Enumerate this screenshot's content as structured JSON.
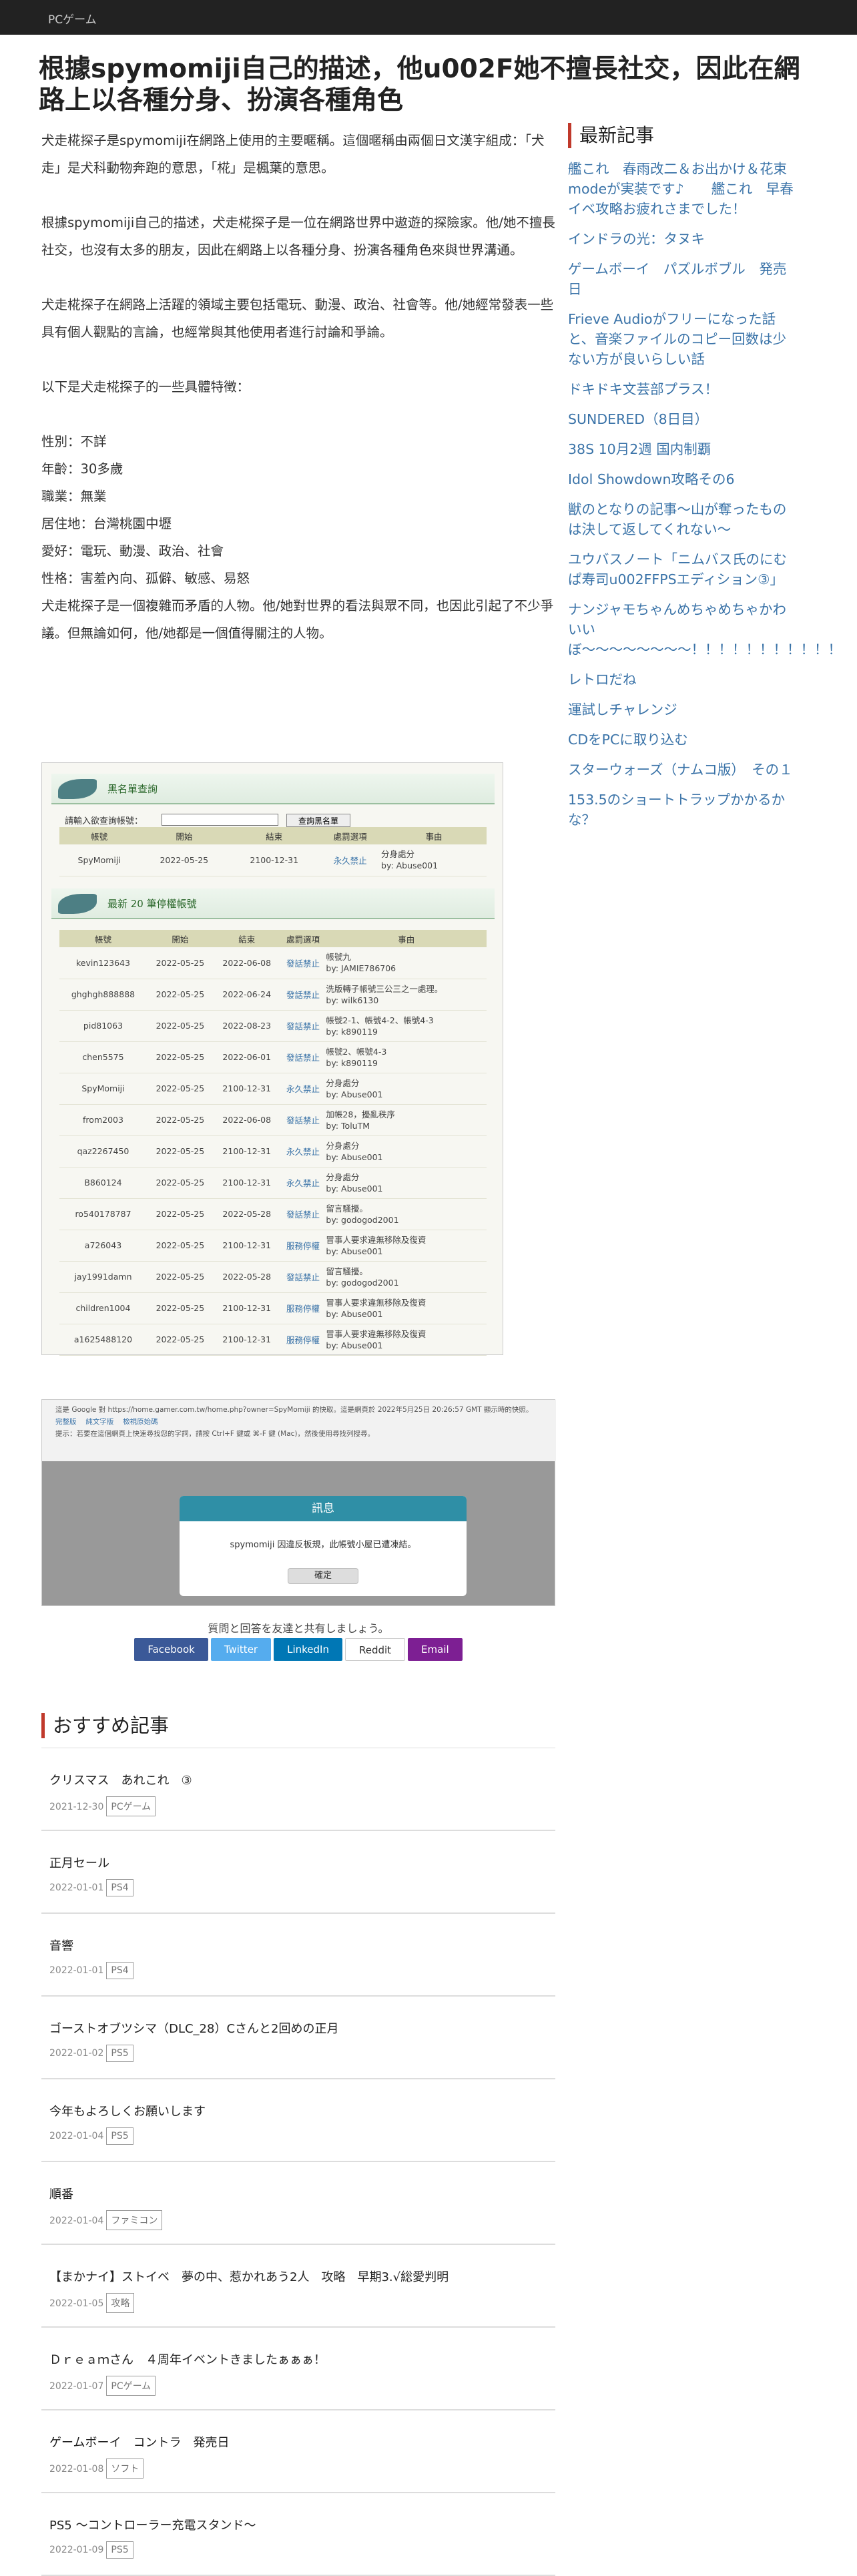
{
  "topbar": {
    "category": "PCゲーム"
  },
  "article": {
    "title": "根據spymomiji自己的描述，他u002F她不擅長社交，因此在網路上以各種分身、扮演各種角色",
    "paragraphs": [
      "犬走椛探子是spymomiji在網路上使用的主要暱稱。這個暱稱由兩個日文漢字組成：「犬走」是犬科動物奔跑的意思，「椛」是楓葉的意思。",
      "根據spymomiji自己的描述，犬走椛探子是一位在網路世界中遨遊的探險家。他/她不擅長社交，也沒有太多的朋友，因此在網路上以各種分身、扮演各種角色來與世界溝通。",
      "犬走椛探子在網路上活躍的領域主要包括電玩、動漫、政治、社會等。他/她經常發表一些具有個人觀點的言論，也經常與其他使用者進行討論和爭論。",
      "以下是犬走椛探子的一些具體特徵："
    ],
    "traits": [
      "性別：不詳",
      "年齡：30多歲",
      "職業：無業",
      "居住地：台灣桃園中壢",
      "愛好：電玩、動漫、政治、社會",
      "性格：害羞內向、孤僻、敏感、易怒"
    ],
    "closing": "犬走椛探子是一個複雜而矛盾的人物。他/她對世界的看法與眾不同，也因此引起了不少爭議。但無論如何，他/她都是一個值得關注的人物。"
  },
  "sidebar": {
    "heading": "最新記事",
    "items": [
      "艦これ　春雨改二＆お出かけ＆花束modeが実装です♪　　艦これ　早春イベ攻略お疲れさまでした！",
      "インドラの光：タヌキ",
      "ゲームボーイ　パズルボブル　発売日",
      "Frieve Audioがフリーになった話と、音楽ファイルのコピー回数は少ない方が良いらしい話",
      "ドキドキ文芸部プラス！",
      "SUNDERED（8日目）",
      "38S 10月2週 国内制覇",
      "Idol Showdown攻略その6",
      "獣のとなりの記事〜山が奪ったものは決して返してくれない〜",
      "ユウバスノート「ニムバス氏のにむぱ寿司u002FFPSエディション③」",
      "ナンジャモちゃんめちゃめちゃかわいいぼ〜〜〜〜〜〜〜〜！！！！！！！！！！！",
      "レトロだね",
      "運試しチャレンジ",
      "CDをPCに取り込む",
      "スターウォーズ（ナムコ版）　その１",
      "153.5のショートトラップかかるかな？"
    ]
  },
  "screenshot1": {
    "panel1_title": "黑名單查詢",
    "query_label": "請輸入欲查詢帳號：",
    "query_button": "查詢黑名單",
    "headers": [
      "帳號",
      "開始",
      "結束",
      "處罰選項",
      "事由"
    ],
    "search_row": [
      "SpyMomiji",
      "2022-05-25",
      "2100-12-31",
      "永久禁止",
      "分身處分",
      "by: Abuse001"
    ],
    "panel2_title": "最新 20 筆停權帳號",
    "rows": [
      [
        "kevin123643",
        "2022-05-25",
        "2022-06-08",
        "發話禁止",
        "帳號九",
        "by: JAMIE786706"
      ],
      [
        "ghghgh888888",
        "2022-05-25",
        "2022-06-24",
        "發話禁止",
        "洗版轉子帳號三公三之一處理。",
        "by: wilk6130"
      ],
      [
        "pid81063",
        "2022-05-25",
        "2022-08-23",
        "發話禁止",
        "帳號2-1、帳號4-2、帳號4-3",
        "by: k890119"
      ],
      [
        "chen5575",
        "2022-05-25",
        "2022-06-01",
        "發話禁止",
        "帳號2、帳號4-3",
        "by: k890119"
      ],
      [
        "SpyMomiji",
        "2022-05-25",
        "2100-12-31",
        "永久禁止",
        "分身處分",
        "by: Abuse001"
      ],
      [
        "from2003",
        "2022-05-25",
        "2022-06-08",
        "發話禁止",
        "加帳28，擾亂秩序",
        "by: ToluTM"
      ],
      [
        "qaz2267450",
        "2022-05-25",
        "2100-12-31",
        "永久禁止",
        "分身處分",
        "by: Abuse001"
      ],
      [
        "B860124",
        "2022-05-25",
        "2100-12-31",
        "永久禁止",
        "分身處分",
        "by: Abuse001"
      ],
      [
        "ro540178787",
        "2022-05-25",
        "2022-05-28",
        "發話禁止",
        "留言騷擾。",
        "by: godogod2001"
      ],
      [
        "a726043",
        "2022-05-25",
        "2100-12-31",
        "服務停權",
        "冒事人要求違無移除及復資",
        "by: Abuse001"
      ],
      [
        "jay1991damn",
        "2022-05-25",
        "2022-05-28",
        "發話禁止",
        "留言騷擾。",
        "by: godogod2001"
      ],
      [
        "children1004",
        "2022-05-25",
        "2100-12-31",
        "服務停權",
        "冒事人要求違無移除及復資",
        "by: Abuse001"
      ],
      [
        "a1625488120",
        "2022-05-25",
        "2100-12-31",
        "服務停權",
        "冒事人要求違無移除及復資",
        "by: Abuse001"
      ]
    ]
  },
  "screenshot2": {
    "header_line": "這是 Google 對 https://home.gamer.com.tw/home.php?owner=SpyMomiji 的快取。這是網頁於 2022年5月25日 20:26:57 GMT 顯示時的快照。",
    "links": [
      "完整版",
      "純文字版",
      "檢視原始碼"
    ],
    "notice": "提示：若要在這個網頁上快速尋找您的字詞，請按 Ctrl+F 鍵或 ⌘-F 鍵 (Mac)，然後使用尋找列搜尋。",
    "dialog_title": "訊息",
    "dialog_message": "spymomiji 因違反板規，此帳號小屋已遭凍結。",
    "dialog_button": "確定"
  },
  "share": {
    "label": "質問と回答を友達と共有しましょう。",
    "buttons": [
      {
        "label": "Facebook",
        "color": "#3b5998"
      },
      {
        "label": "Twitter",
        "color": "#55acee"
      },
      {
        "label": "LinkedIn",
        "color": "#0077b5"
      },
      {
        "label": "Reddit",
        "color": "#ffffff"
      },
      {
        "label": "Email",
        "color": "#7d1f93"
      }
    ]
  },
  "recommended": {
    "heading": "おすすめ記事",
    "items": [
      {
        "title": "クリスマス　あれこれ　③",
        "date": "2021-12-30",
        "tag": "PCゲーム"
      },
      {
        "title": "正月セール",
        "date": "2022-01-01",
        "tag": "PS4"
      },
      {
        "title": "音響",
        "date": "2022-01-01",
        "tag": "PS4"
      },
      {
        "title": "ゴーストオブツシマ（DLC_28）Cさんと2回めの正月",
        "date": "2022-01-02",
        "tag": "PS5"
      },
      {
        "title": "今年もよろしくお願いします",
        "date": "2022-01-04",
        "tag": "PS5"
      },
      {
        "title": "順番",
        "date": "2022-01-04",
        "tag": "ファミコン"
      },
      {
        "title": "【まかナイ】ストイベ　夢の中、惹かれあう2人　攻略　早期3.√総愛判明",
        "date": "2022-01-05",
        "tag": "攻略"
      },
      {
        "title": "Ｄｒｅａｍさん　４周年イベントきましたぁぁぁ！",
        "date": "2022-01-07",
        "tag": "PCゲーム"
      },
      {
        "title": "ゲームボーイ　コントラ　発売日",
        "date": "2022-01-08",
        "tag": "ソフト"
      },
      {
        "title": "PS5 〜コントローラー充電スタンド〜",
        "date": "2022-01-09",
        "tag": "PS5"
      }
    ]
  }
}
